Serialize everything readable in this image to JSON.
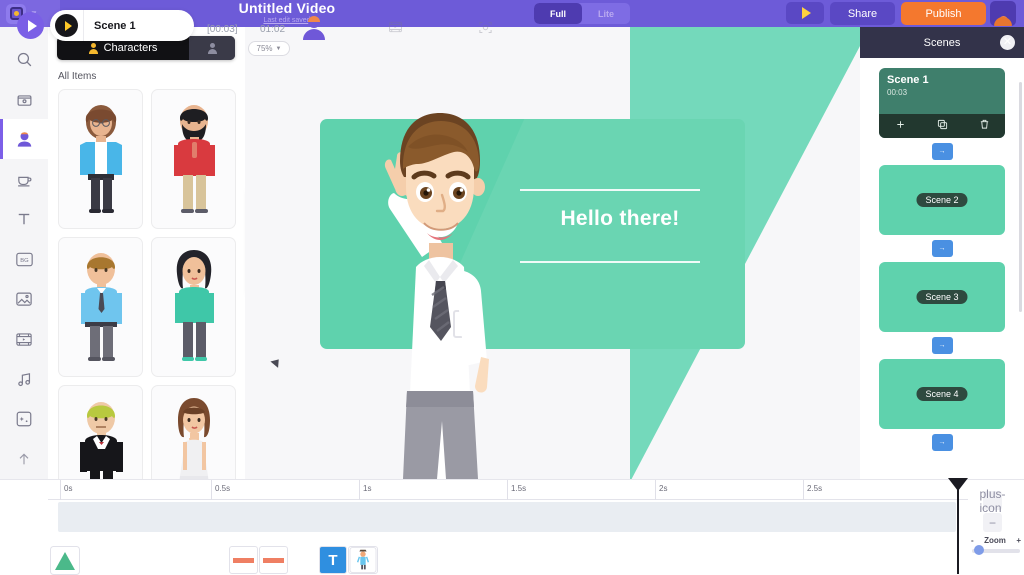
{
  "topbar": {
    "logo_icon": "robot-logo-icon",
    "chevron_icon": "chevron-down-icon",
    "title": "Untitled Video",
    "subtitle": "Last edit saved",
    "mode_full": "Full",
    "mode_lite": "Lite",
    "preview_icon": "play-triangle-icon",
    "share_label": "Share",
    "publish_label": "Publish",
    "avatar_icon": "user-avatar-icon"
  },
  "rail": {
    "items": [
      {
        "icon": "search-icon",
        "active": false
      },
      {
        "icon": "clapperboard-icon",
        "active": false
      },
      {
        "icon": "character-icon",
        "active": true
      },
      {
        "icon": "prop-cup-icon",
        "active": false
      },
      {
        "icon": "text-icon",
        "active": false
      },
      {
        "icon": "background-bg-icon",
        "active": false
      },
      {
        "icon": "image-icon",
        "active": false
      },
      {
        "icon": "video-icon",
        "active": false
      },
      {
        "icon": "music-icon",
        "active": false
      },
      {
        "icon": "effects-icon",
        "active": false
      },
      {
        "icon": "upload-icon",
        "active": false
      }
    ],
    "account_icon": "account-avatar-icon"
  },
  "panel": {
    "tab_label": "Characters",
    "tab_icon": "person-icon",
    "tab2_icon": "person-add-icon",
    "section_label": "All Items",
    "collapse_icon": "chevron-left-icon",
    "items": [
      {
        "name": "woman-blue-cardigan-glasses"
      },
      {
        "name": "man-red-sweater-beard"
      },
      {
        "name": "man-light-blue-shirt-tie"
      },
      {
        "name": "woman-teal-top-curly-hair"
      },
      {
        "name": "man-black-tuxedo-blond"
      },
      {
        "name": "woman-white-dress-brown-hair"
      }
    ]
  },
  "stage": {
    "zoom_level": "75%",
    "zoom_caret_icon": "caret-down-icon",
    "slide_text": "Hello there!",
    "character_name": "waving-man-white-shirt",
    "ghost_plus_icon": "plus-icon",
    "ghost_trash_icon": "trash-icon",
    "ghost_blue_icon": "transition-icon"
  },
  "playbar": {
    "play_icon": "play-icon",
    "scene_play_icon": "play-icon",
    "scene_label": "Scene 1",
    "current_time": "[00:03]",
    "total_time": "01:02",
    "character_icon": "character-icon",
    "video_icon": "video-icon",
    "focus_icon": "focus-icon"
  },
  "scenes": {
    "title": "Scenes",
    "close_icon": "close-icon",
    "transition_icon": "arrow-right-icon",
    "items": [
      {
        "name": "Scene 1",
        "duration": "00:03",
        "selected": true,
        "actions": [
          {
            "icon": "plus-icon",
            "glyph": "+"
          },
          {
            "icon": "duplicate-icon",
            "glyph": "❐"
          },
          {
            "icon": "trash-icon",
            "glyph": "🗑"
          }
        ]
      },
      {
        "name": "Scene 2",
        "duration": "",
        "selected": false
      },
      {
        "name": "Scene 3",
        "duration": "",
        "selected": false
      },
      {
        "name": "Scene 4",
        "duration": "",
        "selected": false
      }
    ]
  },
  "timeline": {
    "ticks": [
      "0s",
      "0.5s",
      "1s",
      "1.5s",
      "2s",
      "2.5s"
    ],
    "clips": [
      {
        "name": "background-clip",
        "type": "triangle"
      },
      {
        "name": "line-clip-1",
        "type": "line"
      },
      {
        "name": "line-clip-2",
        "type": "line"
      },
      {
        "name": "text-clip",
        "type": "text",
        "glyph": "T"
      },
      {
        "name": "character-clip",
        "type": "character"
      }
    ],
    "zoom_in_icon": "plus-icon",
    "zoom_out_icon": "minus-icon",
    "zoom_minus_label": "-",
    "zoom_label": "Zoom",
    "zoom_plus_label": "+",
    "add_track_icon": "plus-icon"
  },
  "colors": {
    "brand_purple": "#6d5bd8",
    "publish_orange": "#f4782e",
    "mint": "#5fd2ad",
    "scene_dark": "#33334a",
    "accent_blue": "#4a90e2"
  }
}
